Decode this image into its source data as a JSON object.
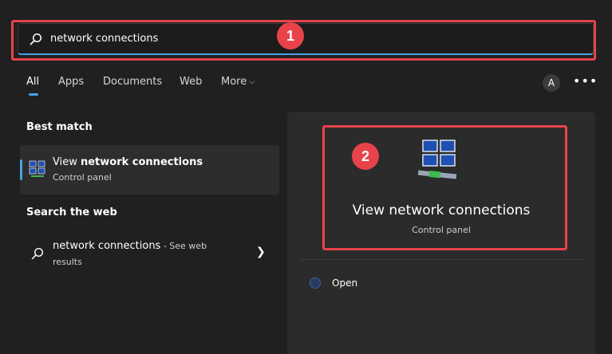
{
  "search": {
    "value": "network connections"
  },
  "annotations": {
    "badge1": "1",
    "badge2": "2"
  },
  "tabs": [
    {
      "label": "All"
    },
    {
      "label": "Apps"
    },
    {
      "label": "Documents"
    },
    {
      "label": "Web"
    },
    {
      "label": "More"
    }
  ],
  "account": {
    "initial": "A",
    "more_icon": "ellipsis-icon"
  },
  "best_match": {
    "heading": "Best match",
    "title_prefix": "View ",
    "title_bold": "network connections",
    "subtitle": "Control panel",
    "icon": "network-computers-icon"
  },
  "search_web": {
    "heading": "Search the web",
    "query": "network connections",
    "suffix": " - See web",
    "suffix_line2": "results",
    "icon": "search-icon"
  },
  "detail": {
    "title": "View network connections",
    "subtitle": "Control panel",
    "actions": [
      {
        "label": "Open",
        "icon": "open-icon"
      }
    ]
  },
  "colors": {
    "background": "#202020",
    "panel": "#2b2b2b",
    "accent": "#4ca0e0",
    "annotation": "#e8434a"
  }
}
